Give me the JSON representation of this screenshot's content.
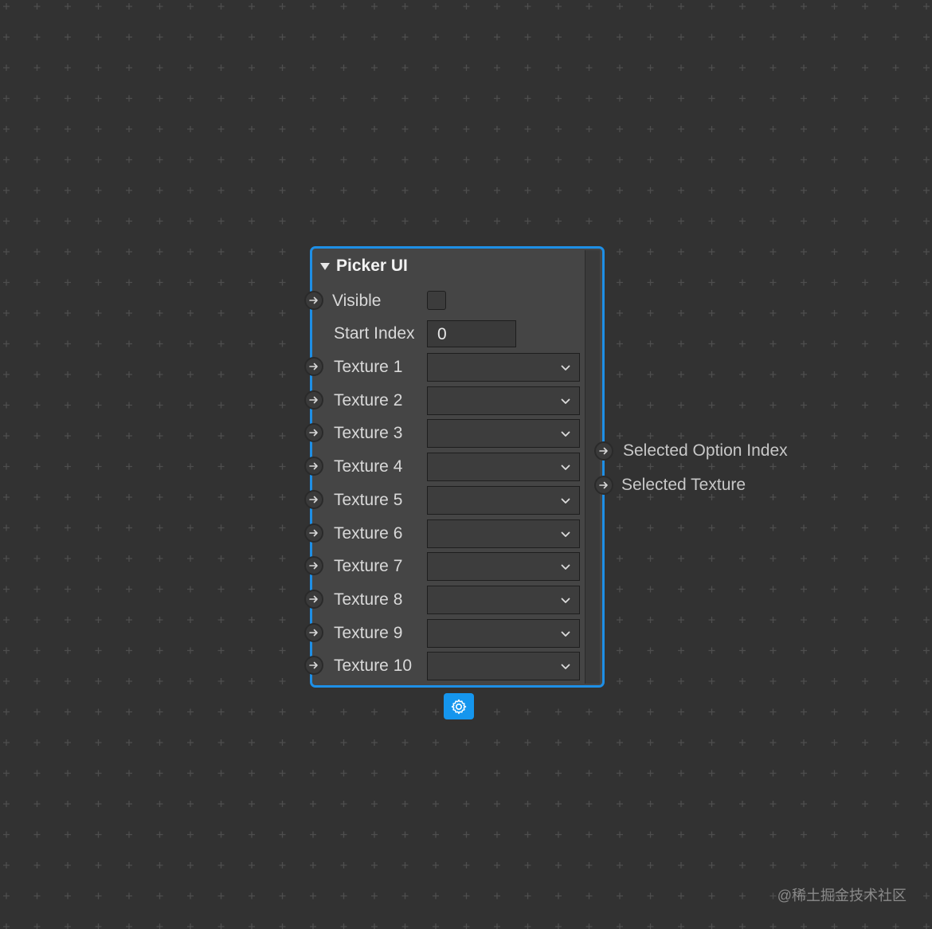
{
  "node": {
    "title": "Picker UI",
    "visible_label": "Visible",
    "visible_checked": false,
    "start_index_label": "Start Index",
    "start_index_value": "0",
    "texture_labels": [
      "Texture 1",
      "Texture 2",
      "Texture 3",
      "Texture 4",
      "Texture 5",
      "Texture 6",
      "Texture 7",
      "Texture 8",
      "Texture 9",
      "Texture 10"
    ],
    "outputs": [
      "Selected Option Index",
      "Selected Texture"
    ]
  },
  "icons": {
    "collapse": "triangle-down-icon",
    "port": "arrow-right-icon",
    "dropdown": "chevron-down-icon",
    "settings": "gear-icon"
  },
  "colors": {
    "accent": "#1e8fe6",
    "background": "#323232",
    "node_fill": "#454545"
  },
  "watermark": "@稀土掘金技术社区"
}
